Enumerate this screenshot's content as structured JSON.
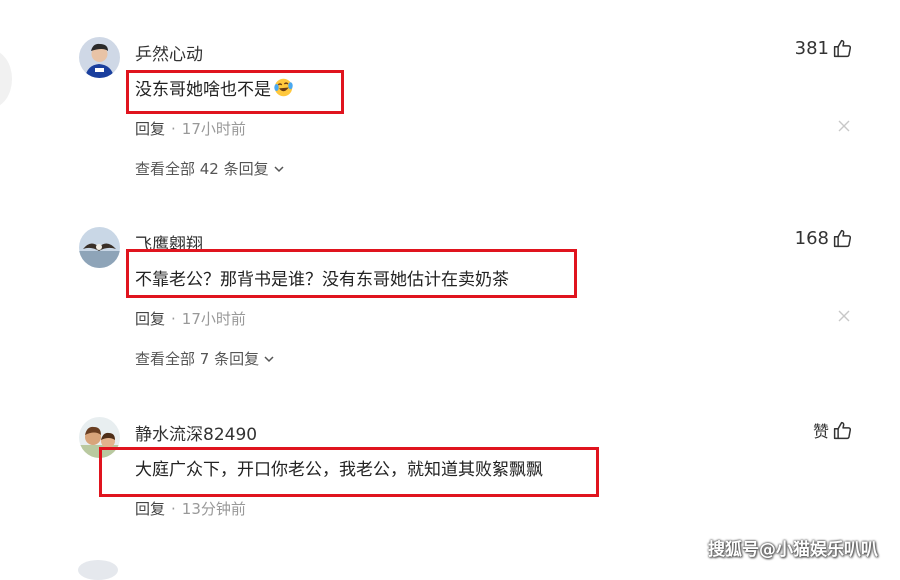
{
  "comments": [
    {
      "username": "乒然心动",
      "likes": "381",
      "text": "没东哥她啥也不是",
      "emoji": "laughing-crying-emoji",
      "reply_label": "回复",
      "time": "17小时前",
      "view_all": "查看全部 42 条回复"
    },
    {
      "username": "飞鹰翱翔",
      "likes": "168",
      "text": "不靠老公？那背书是谁？没有东哥她估计在卖奶茶",
      "reply_label": "回复",
      "time": "17小时前",
      "view_all": "查看全部 7 条回复"
    },
    {
      "username": "静水流深82490",
      "likes": "赞",
      "text": "大庭广众下，开口你老公，我老公，就知道其败絮飘飘",
      "reply_label": "回复",
      "time": "13分钟前"
    }
  ],
  "watermark": "搜狐号@小猫娱乐叭叭",
  "colors": {
    "highlight": "#e0141e",
    "meta": "#999999"
  }
}
